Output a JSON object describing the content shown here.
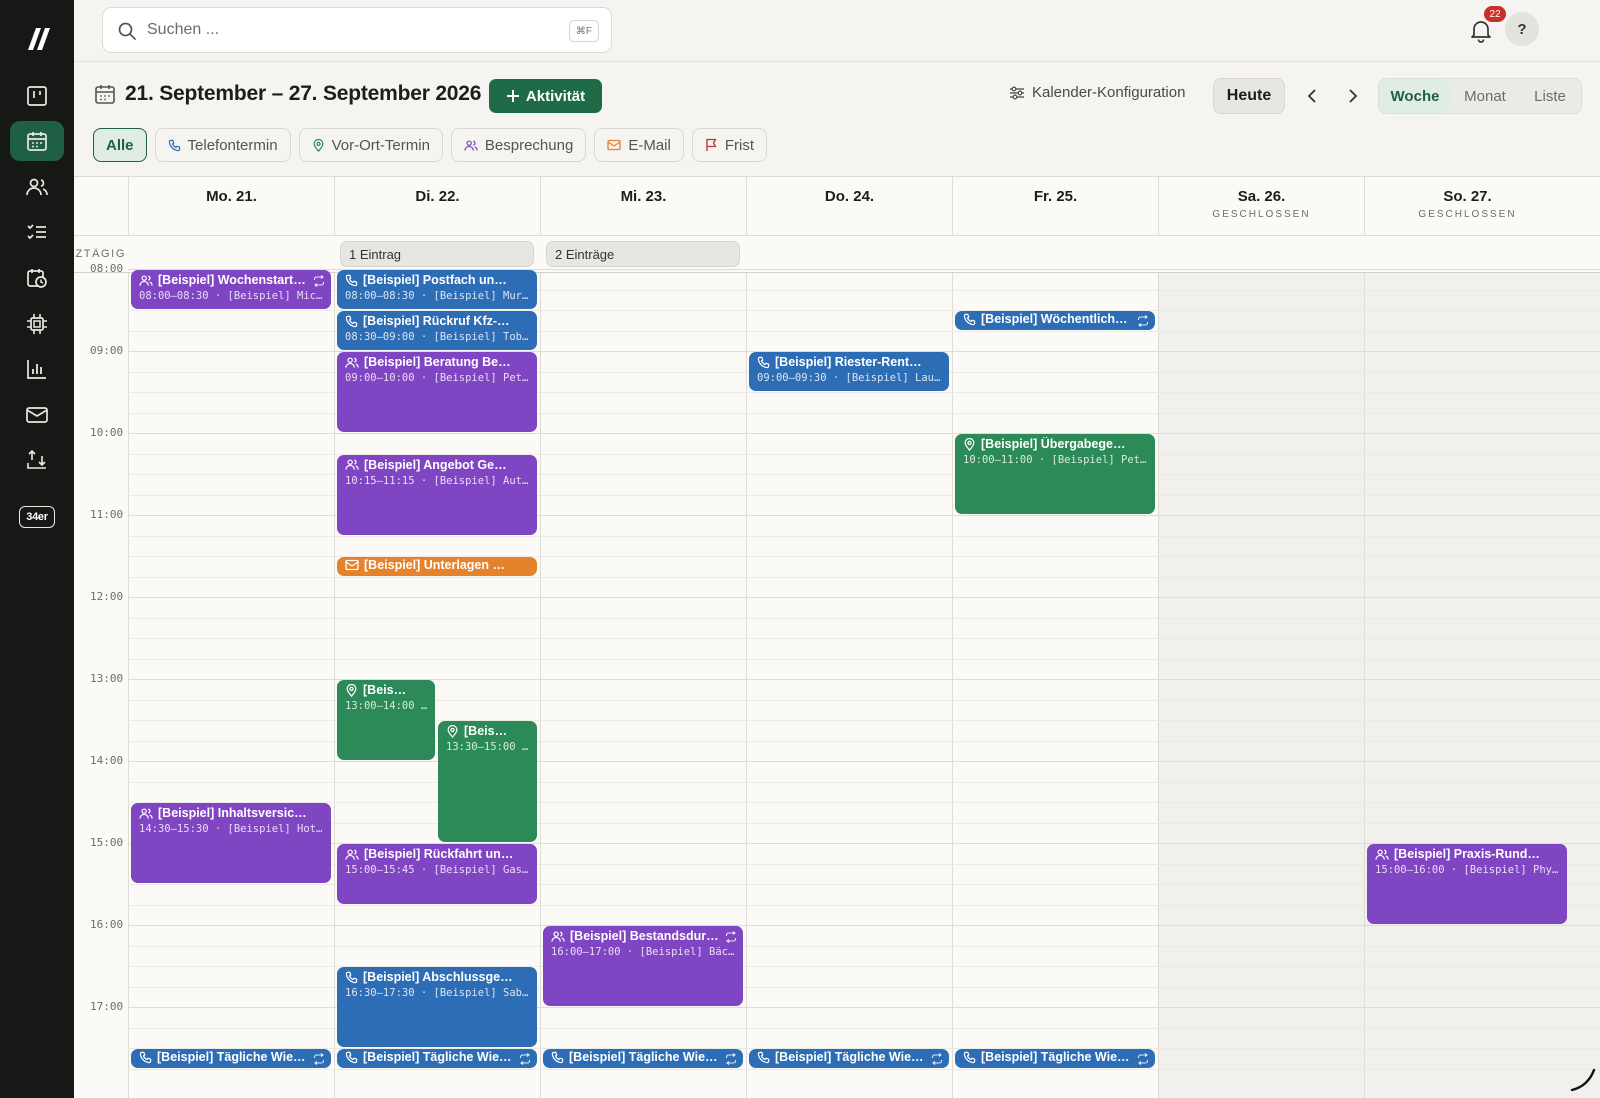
{
  "sidebar": {
    "nav": [
      {
        "name": "board-icon"
      },
      {
        "name": "calendar-icon",
        "active": true
      },
      {
        "name": "users-icon"
      },
      {
        "name": "task-list-icon"
      },
      {
        "name": "calendar-clock-icon"
      },
      {
        "name": "chip-icon"
      },
      {
        "name": "bar-chart-icon"
      },
      {
        "name": "mail-icon"
      },
      {
        "name": "import-export-icon"
      }
    ],
    "badge_label": "34er"
  },
  "topbar": {
    "search_placeholder": "Suchen ...",
    "search_shortcut": "⌘F",
    "notification_count": "22",
    "help_label": "?"
  },
  "header": {
    "range_title": "21. September – 27. September 2026",
    "add_button": "Aktivität",
    "config_label": "Kalender-Konfiguration",
    "today_button": "Heute",
    "views": [
      "Woche",
      "Monat",
      "Liste"
    ],
    "active_view": "Woche"
  },
  "filters": [
    {
      "label": "Alle",
      "icon": "",
      "active": true
    },
    {
      "label": "Telefontermin",
      "icon": "phone-icon"
    },
    {
      "label": "Vor-Ort-Termin",
      "icon": "location-pin-icon"
    },
    {
      "label": "Besprechung",
      "icon": "people-icon"
    },
    {
      "label": "E-Mail",
      "icon": "mail-icon"
    },
    {
      "label": "Frist",
      "icon": "flag-icon"
    }
  ],
  "calendar": {
    "allday_label": "GANZTÄGIG",
    "days": [
      {
        "label": "Mo. 21.",
        "sub": ""
      },
      {
        "label": "Di. 22.",
        "sub": ""
      },
      {
        "label": "Mi. 23.",
        "sub": ""
      },
      {
        "label": "Do. 24.",
        "sub": ""
      },
      {
        "label": "Fr. 25.",
        "sub": ""
      },
      {
        "label": "Sa. 26.",
        "sub": "GESCHLOSSEN"
      },
      {
        "label": "So. 27.",
        "sub": "GESCHLOSSEN"
      }
    ],
    "allday": [
      {
        "day": 1,
        "label": "1 Eintrag"
      },
      {
        "day": 2,
        "label": "2 Einträge"
      }
    ],
    "hours": [
      "08:00",
      "09:00",
      "10:00",
      "11:00",
      "12:00",
      "13:00",
      "14:00",
      "15:00",
      "16:00",
      "17:00"
    ],
    "events": [
      {
        "day": 0,
        "start": 8.0,
        "end": 8.5,
        "type": "meeting",
        "color": "purple",
        "title": "[Beispiel] Wochenstart…",
        "meta": "08:00–08:30 · [Beispiel] Mich…",
        "recurring": true
      },
      {
        "day": 1,
        "start": 8.0,
        "end": 8.5,
        "type": "phone",
        "color": "blue",
        "title": "[Beispiel] Postfach und R…",
        "meta": "08:00–08:30 · [Beispiel] Mura…"
      },
      {
        "day": 1,
        "start": 8.5,
        "end": 9.0,
        "type": "phone",
        "color": "blue",
        "title": "[Beispiel] Rückruf Kfz-Sc…",
        "meta": "08:30–09:00 · [Beispiel] Tobi…"
      },
      {
        "day": 4,
        "start": 8.5,
        "end": 8.75,
        "type": "phone",
        "color": "blue",
        "title": "[Beispiel] Wöchentlich…",
        "meta": "",
        "recurring": true,
        "slim": true
      },
      {
        "day": 1,
        "start": 9.0,
        "end": 10.0,
        "type": "meeting",
        "color": "purple",
        "title": "[Beispiel] Beratung Beruf…",
        "meta": "09:00–10:00 · [Beispiel] Pete…"
      },
      {
        "day": 3,
        "start": 9.0,
        "end": 9.5,
        "type": "phone",
        "color": "blue",
        "title": "[Beispiel] Riester-Rente D…",
        "meta": "09:00–09:30 · [Beispiel] Laur…"
      },
      {
        "day": 4,
        "start": 10.0,
        "end": 11.0,
        "type": "location",
        "color": "green",
        "title": "[Beispiel] Übergabegespr…",
        "meta": "10:00–11:00 · [Beispiel] Petr…"
      },
      {
        "day": 1,
        "start": 10.25,
        "end": 11.25,
        "type": "meeting",
        "color": "purple",
        "title": "[Beispiel] Angebot Gewer…",
        "meta": "10:15–11:15 · [Beispiel] Auto…"
      },
      {
        "day": 1,
        "start": 11.5,
        "end": 11.75,
        "type": "mail",
        "color": "orange",
        "title": "[Beispiel] Unterlagen Ren…",
        "meta": "",
        "slim": true
      },
      {
        "day": 1,
        "start": 13.0,
        "end": 14.0,
        "type": "location",
        "color": "green",
        "title": "[Beispiel…",
        "meta": "13:00–14:00 …",
        "half": "left"
      },
      {
        "day": 1,
        "start": 13.5,
        "end": 15.0,
        "type": "location",
        "color": "green",
        "title": "[Beispiel…",
        "meta": "13:30–15:00 …",
        "half": "right"
      },
      {
        "day": 0,
        "start": 14.5,
        "end": 15.5,
        "type": "meeting",
        "color": "purple",
        "title": "[Beispiel] Inhaltsversicher…",
        "meta": "14:30–15:30 · [Beispiel] Hote…"
      },
      {
        "day": 1,
        "start": 15.0,
        "end": 15.75,
        "type": "meeting",
        "color": "purple",
        "title": "[Beispiel] Rückfahrt und …",
        "meta": "15:00–15:45 · [Beispiel] Gast…"
      },
      {
        "day": 6,
        "start": 15.0,
        "end": 16.0,
        "type": "meeting",
        "color": "purple",
        "title": "[Beispiel] Praxis-Rundgan…",
        "meta": "15:00–16:00 · [Beispiel] Phys…"
      },
      {
        "day": 2,
        "start": 16.0,
        "end": 17.0,
        "type": "meeting",
        "color": "purple",
        "title": "[Beispiel] Bestandsdur…",
        "meta": "16:00–17:00 · [Beispiel] Bäck…",
        "recurring": true
      },
      {
        "day": 1,
        "start": 16.5,
        "end": 17.5,
        "type": "phone",
        "color": "blue",
        "title": "[Beispiel] Abschlussgespr…",
        "meta": "16:30–17:30 · [Beispiel] Sabi…"
      },
      {
        "day": 0,
        "start": 17.5,
        "end": 17.75,
        "type": "phone",
        "color": "blue",
        "title": "[Beispiel] Tägliche Wie…",
        "meta": "",
        "recurring": true,
        "slim": true
      },
      {
        "day": 1,
        "start": 17.5,
        "end": 17.75,
        "type": "phone",
        "color": "blue",
        "title": "[Beispiel] Tägliche Wie…",
        "meta": "",
        "recurring": true,
        "slim": true
      },
      {
        "day": 2,
        "start": 17.5,
        "end": 17.75,
        "type": "phone",
        "color": "blue",
        "title": "[Beispiel] Tägliche Wie…",
        "meta": "",
        "recurring": true,
        "slim": true
      },
      {
        "day": 3,
        "start": 17.5,
        "end": 17.75,
        "type": "phone",
        "color": "blue",
        "title": "[Beispiel] Tägliche Wie…",
        "meta": "",
        "recurring": true,
        "slim": true
      },
      {
        "day": 4,
        "start": 17.5,
        "end": 17.75,
        "type": "phone",
        "color": "blue",
        "title": "[Beispiel] Tägliche Wie…",
        "meta": "",
        "recurring": true,
        "slim": true
      }
    ]
  },
  "colors": {
    "sidebar_bg": "#161816",
    "accent_green": "#1f6b47",
    "event_purple": "#8045c3",
    "event_blue": "#2d6db5",
    "event_green": "#2b8a57",
    "event_orange": "#e5832c",
    "badge_red": "#c9302c"
  }
}
